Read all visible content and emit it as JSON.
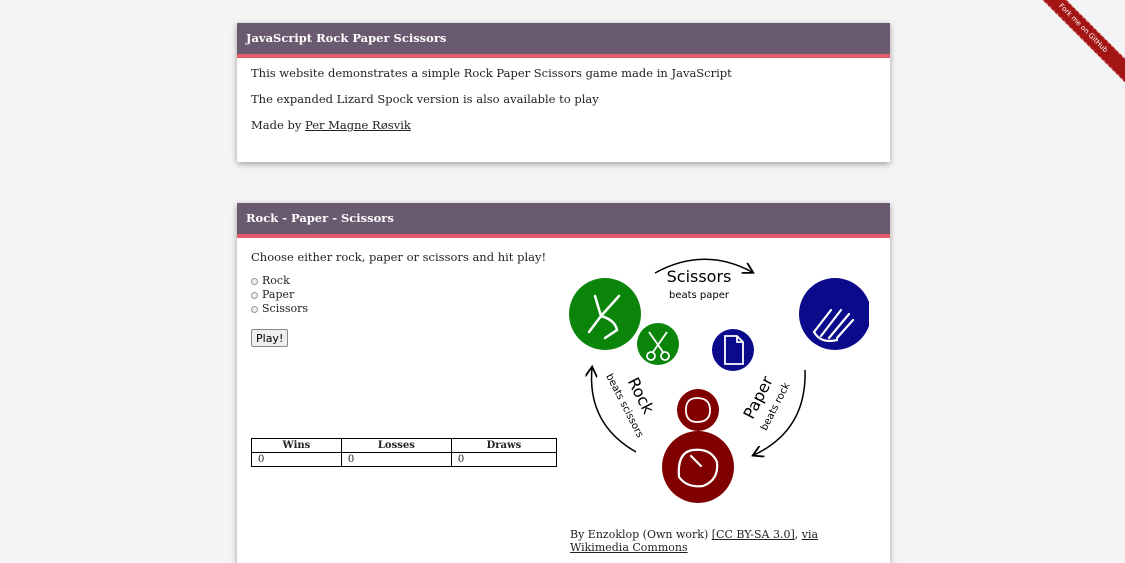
{
  "ribbon": {
    "label": "Fork me on GitHub"
  },
  "intro": {
    "title": "JavaScript Rock Paper Scissors",
    "line1": "This website demonstrates a simple Rock Paper Scissors game made in JavaScript",
    "line2": "The expanded Lizard Spock version is also available to play",
    "made_by_prefix": "Made by ",
    "author_link": "Per Magne Røsvik"
  },
  "game": {
    "title": "Rock - Paper - Scissors",
    "prompt": "Choose either rock, paper or scissors and hit play!",
    "options": [
      "Rock",
      "Paper",
      "Scissors"
    ],
    "play_label": "Play!",
    "score_headers": [
      "Wins",
      "Losses",
      "Draws"
    ],
    "score_values": [
      "0",
      "0",
      "0"
    ]
  },
  "diagram": {
    "scissors_label": "Scissors",
    "scissors_sub": "beats paper",
    "paper_label": "Paper",
    "paper_sub": "beats rock",
    "rock_label": "Rock",
    "rock_sub": "beats scissors",
    "colors": {
      "scissors": "#0a850a",
      "paper": "#0a0a8a",
      "rock": "#800000"
    }
  },
  "credit": {
    "prefix": "By Enzoklop (Own work) ",
    "license_link": "[CC BY-SA 3.0]",
    "sep": ", ",
    "source_link": "via Wikimedia Commons"
  }
}
